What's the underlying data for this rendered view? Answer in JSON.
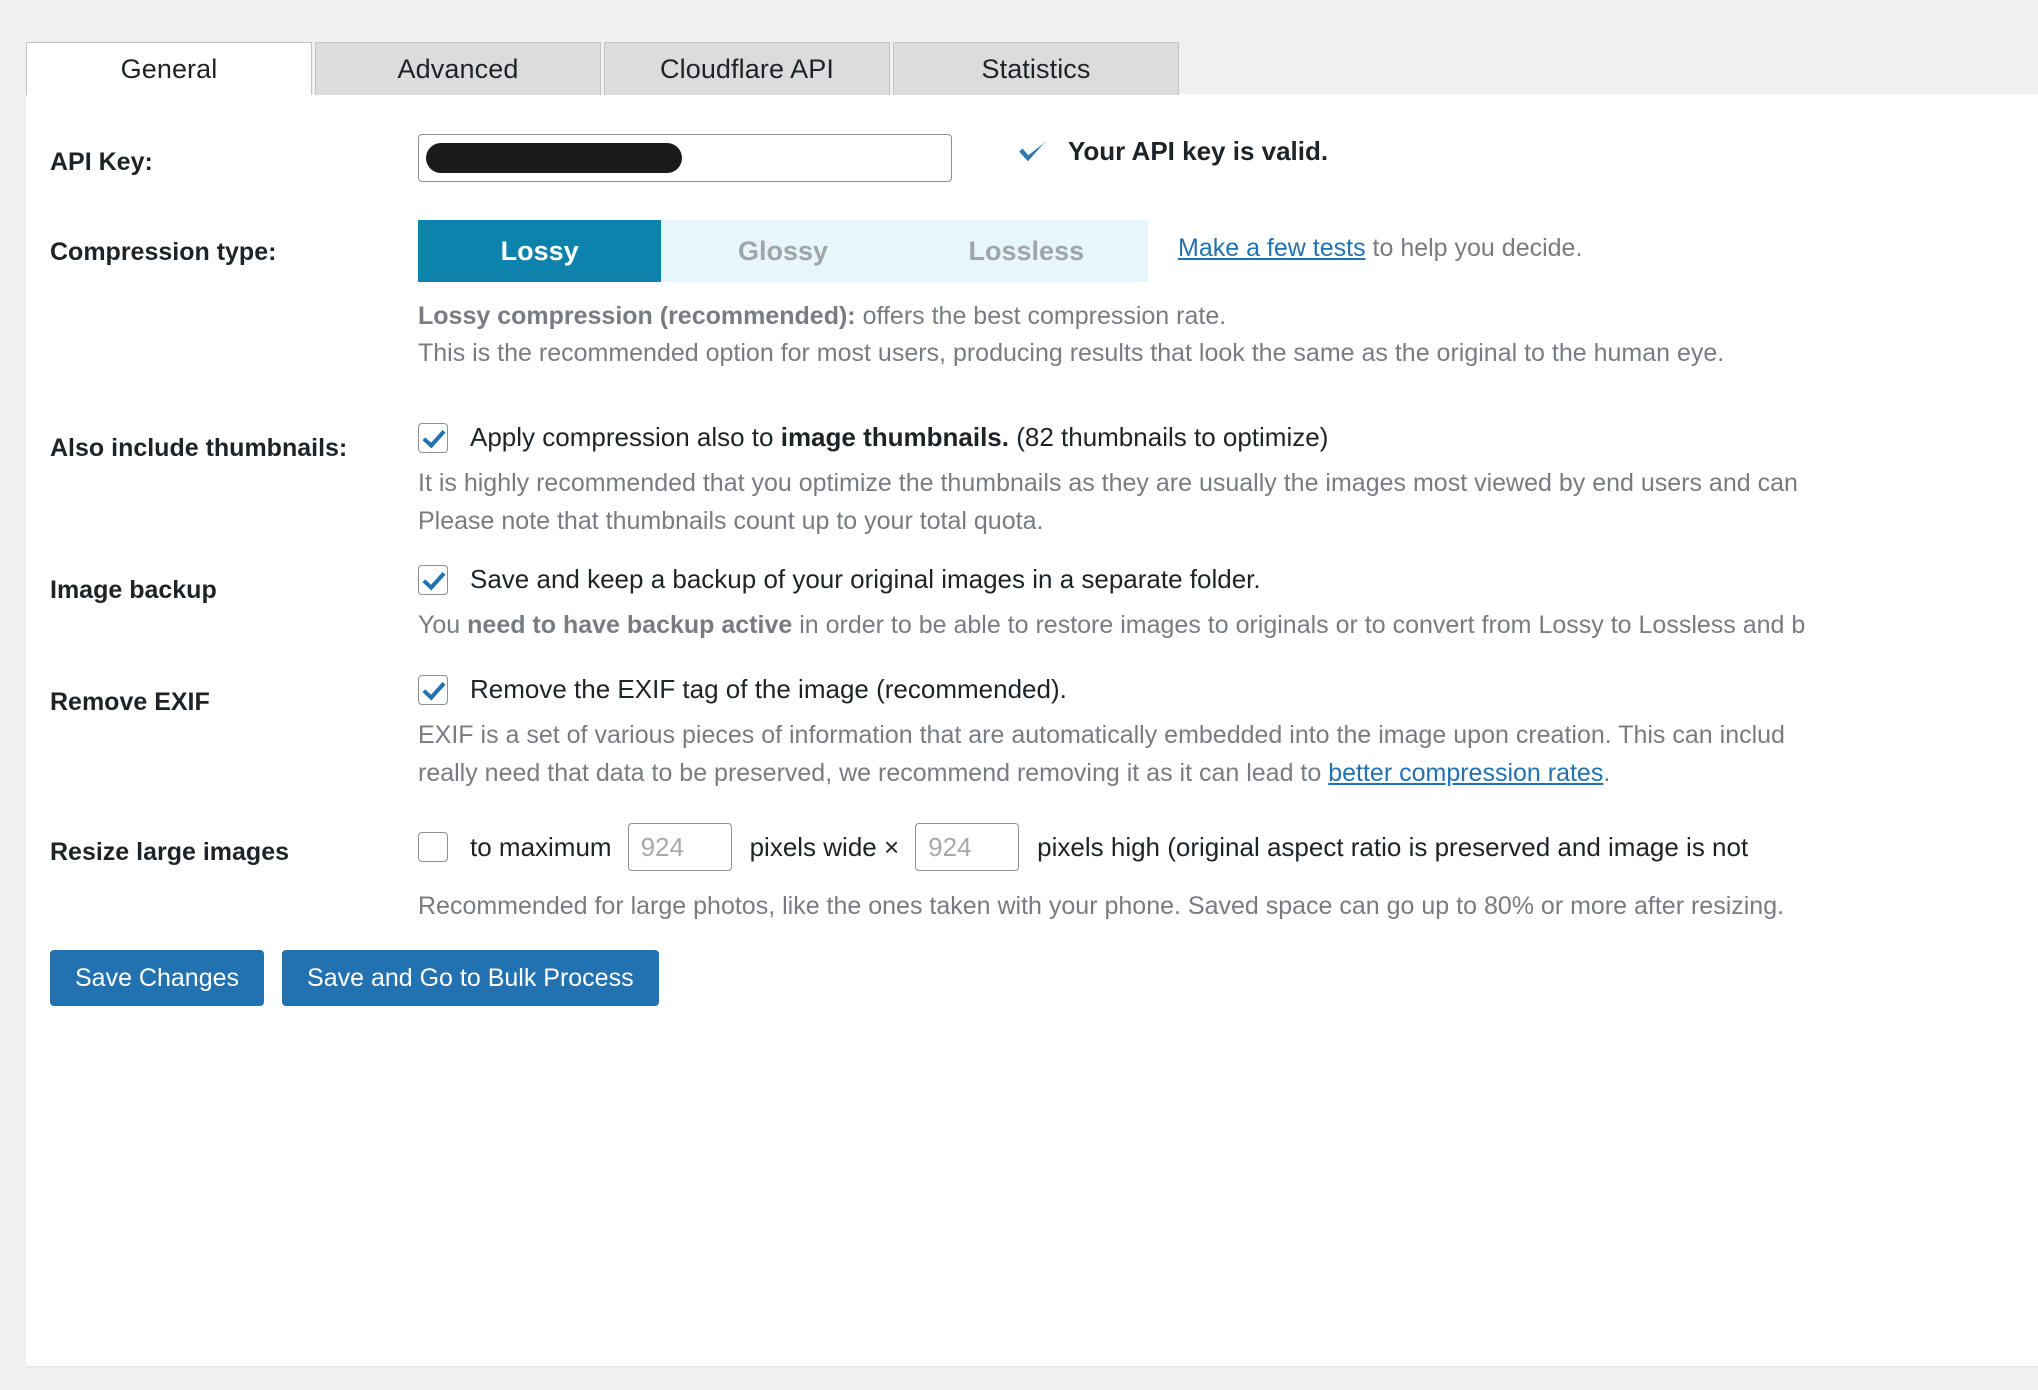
{
  "tabs": [
    {
      "label": "General",
      "active": true
    },
    {
      "label": "Advanced",
      "active": false
    },
    {
      "label": "Cloudflare API",
      "active": false
    },
    {
      "label": "Statistics",
      "active": false
    }
  ],
  "colors": {
    "accent_blue": "#2271b1",
    "toggle_active": "#0d82ad",
    "toggle_track": "#e6f6fb",
    "page_bg": "#f0f0f1",
    "muted_text": "#787c82"
  },
  "api_key": {
    "label": "API Key:",
    "value": "",
    "placeholder": "",
    "status_text": "Your API key is valid.",
    "status_icon": "blue-checkmark-icon"
  },
  "compression": {
    "label": "Compression type:",
    "options": [
      {
        "label": "Lossy",
        "active": true
      },
      {
        "label": "Glossy",
        "active": false
      },
      {
        "label": "Lossless",
        "active": false
      }
    ],
    "hint_link": "Make a few tests",
    "hint_rest": " to help you decide.",
    "desc_bold": "Lossy compression (recommended):",
    "desc_rest": " offers the best compression rate.",
    "desc_line2": "This is the recommended option for most users, producing results that look the same as the original to the human eye."
  },
  "thumbnails": {
    "label": "Also include thumbnails:",
    "checked": true,
    "text_before": "Apply compression also to ",
    "text_bold": "image thumbnails.",
    "text_after": " (82 thumbnails to optimize)",
    "desc_line1": "It is highly recommended that you optimize the thumbnails as they are usually the images most viewed by end users and can",
    "desc_line2": "Please note that thumbnails count up to your total quota."
  },
  "backup": {
    "label": "Image backup",
    "checked": true,
    "text": "Save and keep a backup of your original images in a separate folder.",
    "desc_before": "You ",
    "desc_bold": "need to have backup active",
    "desc_after": " in order to be able to restore images to originals or to convert from Lossy to Lossless and b"
  },
  "exif": {
    "label": "Remove EXIF",
    "checked": true,
    "text": "Remove the EXIF tag of the image (recommended).",
    "desc_line1": "EXIF is a set of various pieces of information that are automatically embedded into the image upon creation. This can includ",
    "desc_line2_before": "really need that data to be preserved, we recommend removing it as it can lead to ",
    "desc_line2_link": "better compression rates",
    "desc_line2_after": "."
  },
  "resize": {
    "label": "Resize large images",
    "checked": false,
    "text_before": "to maximum",
    "width_value": "924",
    "width_placeholder": "924",
    "text_middle": "pixels wide ×",
    "height_value": "924",
    "height_placeholder": "924",
    "text_after": "pixels high (original aspect ratio is preserved and image is not",
    "desc": "Recommended for large photos, like the ones taken with your phone. Saved space can go up to 80% or more after resizing."
  },
  "buttons": {
    "save": "Save Changes",
    "save_bulk": "Save and Go to Bulk Process"
  }
}
